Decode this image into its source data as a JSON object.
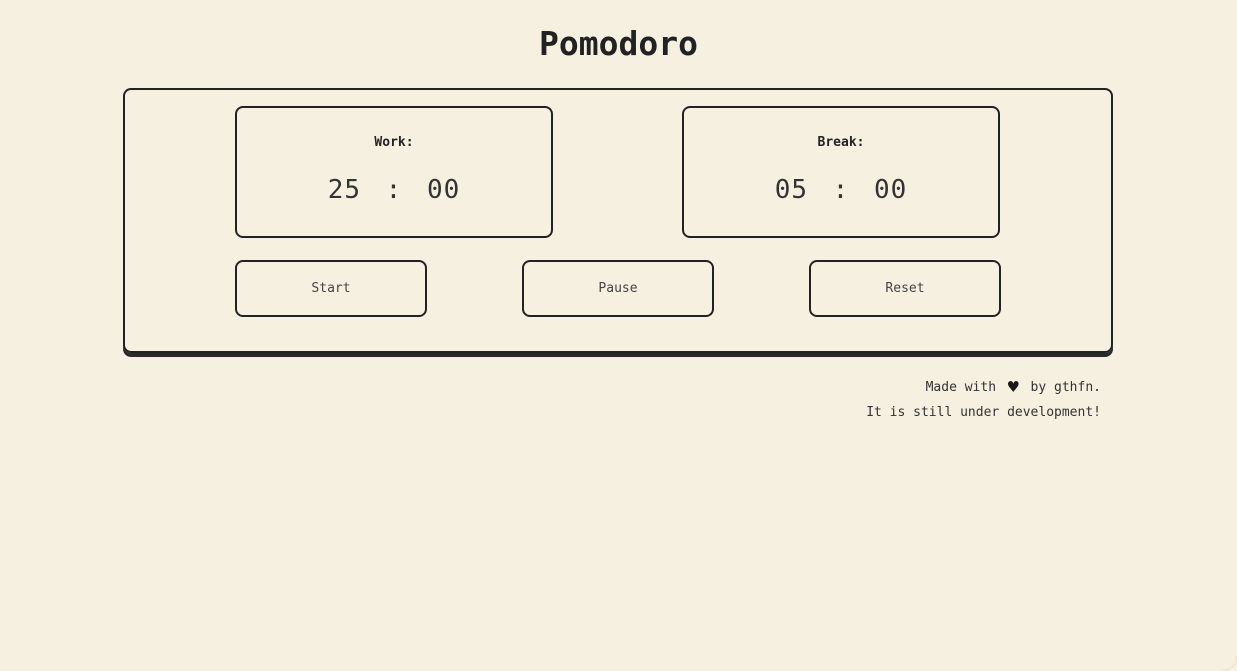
{
  "app": {
    "title": "Pomodoro"
  },
  "timers": {
    "work": {
      "label": "Work:",
      "minutes": "25",
      "separator": ":",
      "seconds": "00"
    },
    "break": {
      "label": "Break:",
      "minutes": "05",
      "separator": ":",
      "seconds": "00"
    }
  },
  "controls": {
    "start_label": "Start",
    "pause_label": "Pause",
    "reset_label": "Reset"
  },
  "footer": {
    "made_with": "Made with",
    "heart_icon": "heart-icon",
    "by": "by",
    "author": "gthfn",
    "period": ".",
    "status": "It is still under development!"
  },
  "colors": {
    "background": "#f6f0e0",
    "ink": "#222222"
  }
}
